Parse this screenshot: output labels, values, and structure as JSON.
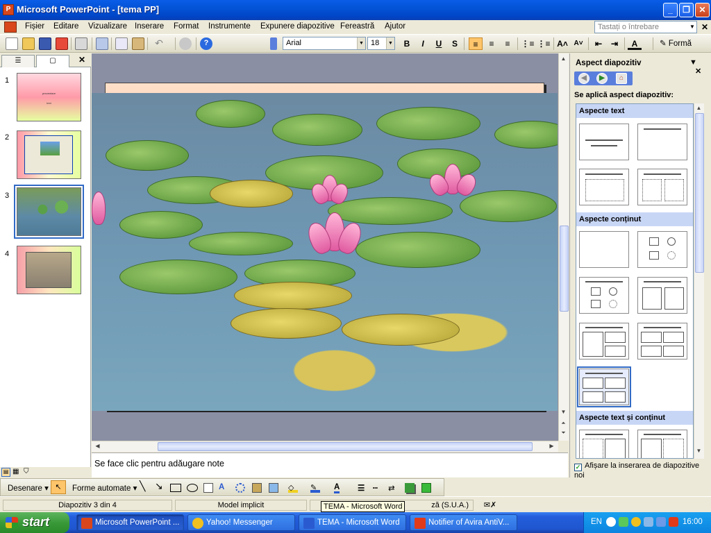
{
  "window": {
    "title": "Microsoft PowerPoint - [tema PP]",
    "minimize": "_",
    "maximize": "❐",
    "close": "✕"
  },
  "menu": {
    "items": [
      "Fișier",
      "Editare",
      "Vizualizare",
      "Inserare",
      "Format",
      "Instrumente",
      "Expunere diapozitive",
      "Fereastră",
      "Ajutor"
    ],
    "help_placeholder": "Tastați o întrebare",
    "doc_close": "✕"
  },
  "toolbar": {
    "font_name": "Arial",
    "font_size": "18",
    "bold": "B",
    "italic": "I",
    "underline": "U",
    "shadow": "S",
    "grow_font": "A˄",
    "shrink_font": "A˅",
    "font_color": "A",
    "design_label": "Formă"
  },
  "outline": {
    "close": "✕",
    "slides": [
      {
        "num": "1",
        "title_text": "prezentare",
        "sub_text": "text"
      },
      {
        "num": "2"
      },
      {
        "num": "3"
      },
      {
        "num": "4"
      }
    ]
  },
  "notes": {
    "placeholder": "Se face clic pentru adăugare note"
  },
  "taskpane": {
    "title": "Aspect diapozitiv",
    "subtitle": "Se aplică aspect diapozitiv:",
    "sections": [
      "Aspecte text",
      "Aspecte conținut",
      "Aspecte text și conținut"
    ],
    "checkbox_label": "Afișare la inserarea de diapozitive noi",
    "checkbox_checked": true
  },
  "drawing": {
    "draw_label": "Desenare",
    "autoshapes_label": "Forme automate"
  },
  "status": {
    "slide_info": "Diapozitiv 3 din 4",
    "design": "Model implicit",
    "language": "ză (S.U.A.)",
    "tooltip": "TEMA - Microsoft Word"
  },
  "taskbar": {
    "start": "start",
    "tasks": [
      {
        "label": "Microsoft PowerPoint ...",
        "active": true,
        "icon_color": "#d9461b"
      },
      {
        "label": "Yahoo! Messenger",
        "active": false,
        "icon_color": "#f0c020"
      },
      {
        "label": "TEMA - Microsoft Word",
        "active": false,
        "icon_color": "#2a5ad0"
      },
      {
        "label": "Notifier of Avira AntiV...",
        "active": false,
        "icon_color": "#e03a1a"
      }
    ],
    "lang": "EN",
    "clock": "16:00"
  }
}
